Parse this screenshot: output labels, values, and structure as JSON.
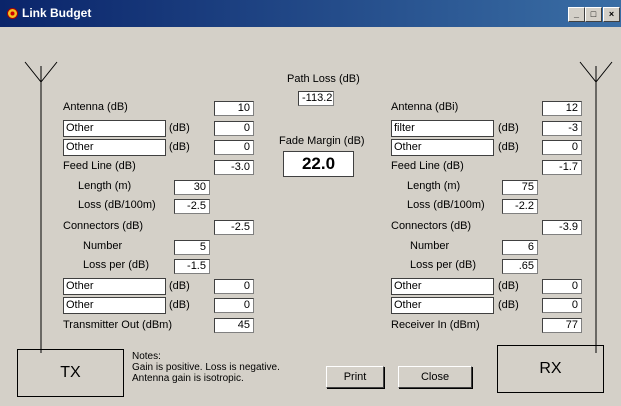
{
  "window": {
    "title": "Link Budget"
  },
  "center": {
    "path_loss_label": "Path Loss (dB)",
    "path_loss_value": "-113.2",
    "fade_margin_label": "Fade Margin (dB)",
    "fade_margin_value": "22.0"
  },
  "tx": {
    "antenna_label": "Antenna (dB)",
    "antenna_value": "10",
    "other1_name": "Other",
    "other1_unit": "(dB)",
    "other1_value": "0",
    "other2_name": "Other",
    "other2_unit": "(dB)",
    "other2_value": "0",
    "feedline_label": "Feed Line (dB)",
    "feedline_value": "-3.0",
    "length_label": "Length (m)",
    "length_value": "30",
    "loss_label": "Loss (dB/100m)",
    "loss_value": "-2.5",
    "connectors_label": "Connectors (dB)",
    "connectors_value": "-2.5",
    "number_label": "Number",
    "number_value": "5",
    "loss_per_label": "Loss per (dB)",
    "loss_per_value": "-1.5",
    "other3_name": "Other",
    "other3_unit": "(dB)",
    "other3_value": "0",
    "other4_name": "Other",
    "other4_unit": "(dB)",
    "other4_value": "0",
    "output_label": "Transmitter Out (dBm)",
    "output_value": "45",
    "box_label": "TX"
  },
  "rx": {
    "antenna_label": "Antenna (dBi)",
    "antenna_value": "12",
    "other1_name": "filter",
    "other1_unit": "(dB)",
    "other1_value": "-3",
    "other2_name": "Other",
    "other2_unit": "(dB)",
    "other2_value": "0",
    "feedline_label": "Feed Line (dB)",
    "feedline_value": "-1.7",
    "length_label": "Length (m)",
    "length_value": "75",
    "loss_label": "Loss (dB/100m)",
    "loss_value": "-2.2",
    "connectors_label": "Connectors (dB)",
    "connectors_value": "-3.9",
    "number_label": "Number",
    "number_value": "6",
    "loss_per_label": "Loss per (dB)",
    "loss_per_value": ".65",
    "other3_name": "Other",
    "other3_unit": "(dB)",
    "other3_value": "0",
    "other4_name": "Other",
    "other4_unit": "(dB)",
    "other4_value": "0",
    "input_label": "Receiver In (dBm)",
    "input_value": "77",
    "box_label": "RX"
  },
  "notes": {
    "line1": "Notes:",
    "line2": "Gain is positive.  Loss is negative.",
    "line3": "Antenna gain is isotropic."
  },
  "buttons": {
    "print": "Print",
    "close": "Close",
    "minimize": "_",
    "maximize": "□",
    "close_x": "×"
  }
}
